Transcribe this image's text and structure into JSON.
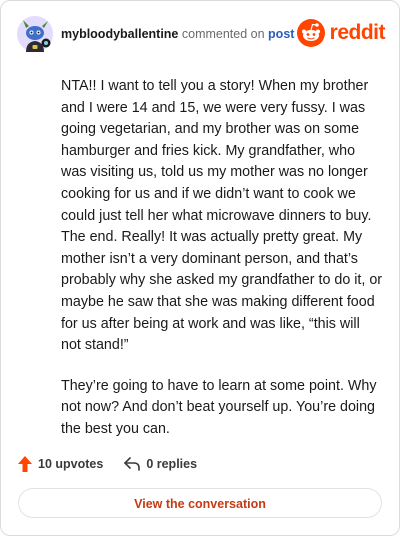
{
  "header": {
    "username": "mybloodyballentine",
    "action_text": "commented on",
    "post_link": "post",
    "brand_name": "reddit",
    "avatar_icon": "snoo-avatar-icon",
    "brand_icon": "reddit-snoo-icon"
  },
  "comment": {
    "paragraphs": [
      "NTA!! I want to tell you a story! When my brother and I were 14 and 15, we were very fussy. I was going vegetarian, and my brother was on some hamburger and fries kick. My grandfather, who was visiting us, told us my mother was no longer cooking for us and if we didn’t want to cook we could just tell her what microwave dinners to buy. The end. Really! It was actually pretty great. My mother isn’t a very dominant person, and that’s probably why she asked my grandfather to do it, or maybe he saw that she was making different food for us after being at work and was like, “this will not stand!”",
      "They’re going to have to learn at some point. Why not now? And don’t beat yourself up. You’re doing the best you can."
    ]
  },
  "actions": {
    "upvotes_label": "10 upvotes",
    "replies_label": "0 replies",
    "upvote_icon": "upvote-arrow-icon",
    "reply_icon": "reply-arrow-icon"
  },
  "footer": {
    "view_conversation_label": "View the conversation"
  },
  "colors": {
    "brand": "#ff4500",
    "link": "#2b5fb8",
    "button_text": "#c53a12",
    "text": "#1a1a1b"
  }
}
